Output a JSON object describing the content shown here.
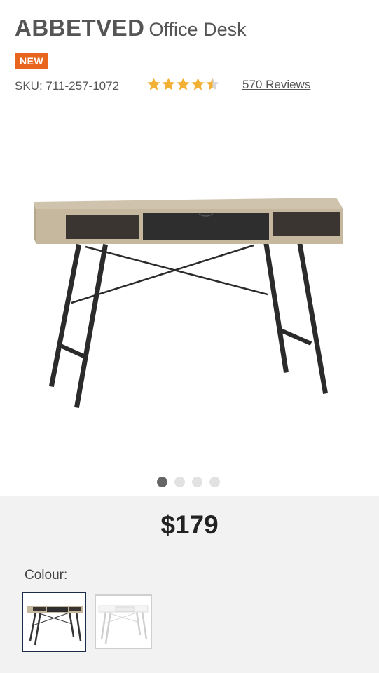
{
  "product": {
    "brand": "ABBETVED",
    "subtitle": "Office Desk",
    "badge": "NEW",
    "sku": "SKU: 711-257-1072",
    "rating": 4.5,
    "rating_color": "#f2b035",
    "reviews": "570 Reviews"
  },
  "gallery": {
    "image": "desk-product-image",
    "current_slide": 1,
    "total_slides": 4
  },
  "price": "$179",
  "colour": {
    "label": "Colour:",
    "selected_index": 0,
    "options": [
      "oak-black",
      "white"
    ]
  },
  "colors": {
    "badge": "#e8651e",
    "selected_border": "#1b2c4d",
    "panel": "#f2f2f2"
  }
}
